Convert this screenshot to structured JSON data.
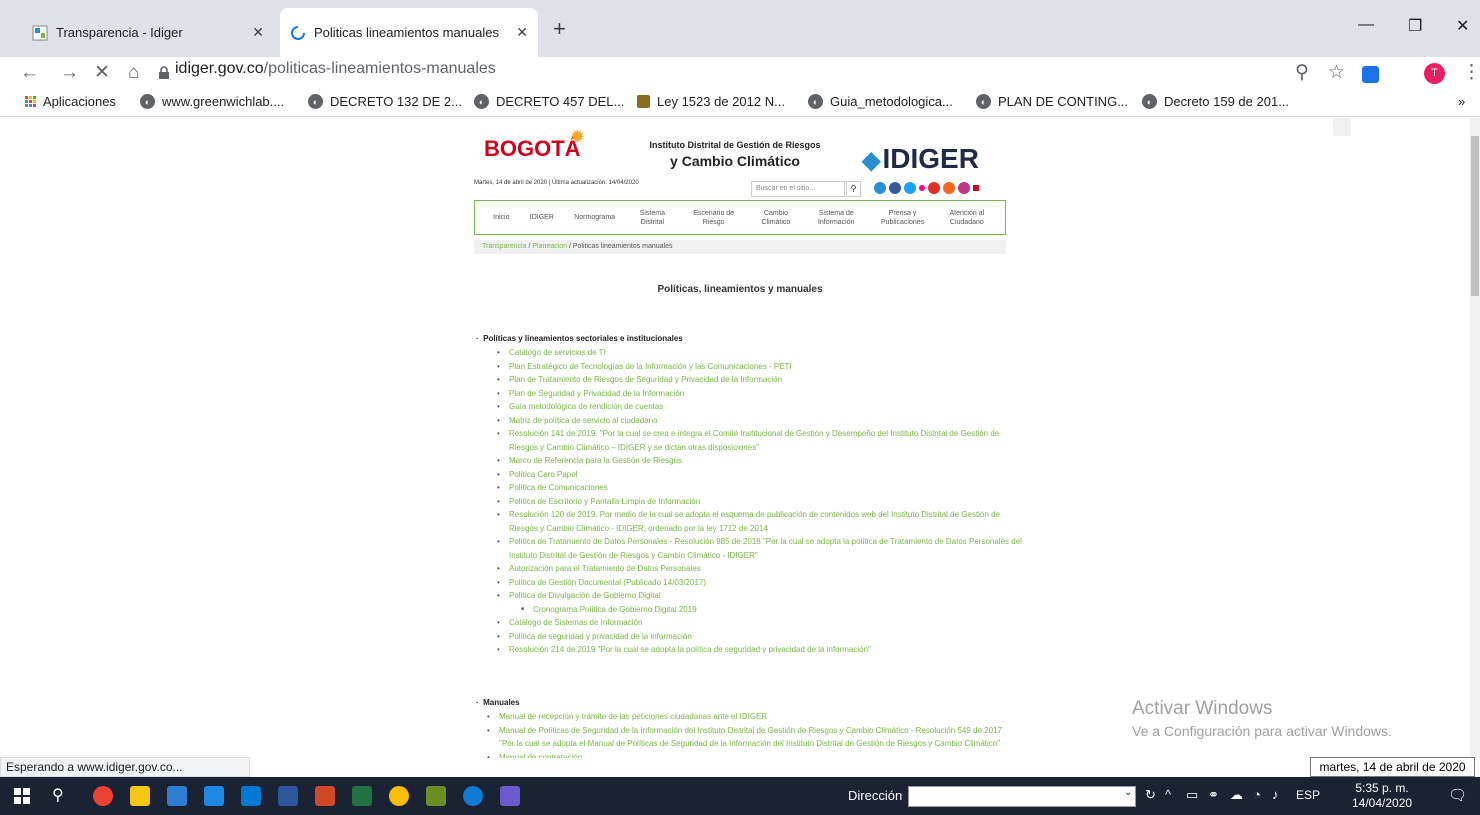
{
  "browser": {
    "tabs": [
      {
        "title": "Transparencia - Idiger",
        "active": false
      },
      {
        "title": "Politicas lineamientos manuales",
        "active": true
      }
    ],
    "new_tab_icon": "plus-icon",
    "url_domain": "idiger.gov.co",
    "url_path": "/politicas-lineamientos-manuales",
    "profile_initial": "T",
    "bookmarks": [
      "Aplicaciones",
      "www.greenwichlab....",
      "DECRETO 132 DE 2...",
      "DECRETO 457 DEL...",
      "Ley 1523 de 2012 N...",
      "Guia_metodologica...",
      "PLAN DE CONTING...",
      "Decreto 159 de 201..."
    ],
    "bookmarks_more": "»",
    "status_text": "Esperando a www.idiger.gov.co...",
    "tooltip_text": "martes, 14 de abril de 2020"
  },
  "site": {
    "logo_left": "BOGOTÁ",
    "institute_line1": "Instituto Distrital de Gestión de Riesgos",
    "institute_line2": "y Cambio Climático",
    "logo_right": "IDIGER",
    "dateline": "Martes, 14 de abril de 2020 | Última actualización: 14/04/2020",
    "search_placeholder": "Buscar en el sitio...",
    "nav": [
      "Inicio",
      "IDIGER",
      "Normograma",
      "Sistema Distrital",
      "Escenario de Riesgo",
      "Cambio Climático",
      "Sistema de Información",
      "Prensa y Publicaciones",
      "Atención al Ciudadano"
    ],
    "breadcrumb": {
      "link1": "Transparencia",
      "link2": "Planeacion",
      "current": "Politicas lineamientos manuales",
      "sep": "/"
    },
    "heading": "Políticas, lineamientos y manuales",
    "section1_title": "Políticas y lineamientos sectoriales e institucionales",
    "section1_items": [
      "Catálogo de servicios de TI",
      "Plan Estratégico de Tecnologías de la Información y las Comunicaciones - PETI",
      "Plan de Tratamiento de Riesgos de Seguridad y Privacidad de la Información",
      "Plan de Seguridad y Privacidad de la Información",
      "Guía metodológica de rendición de cuentas",
      "Matriz de política de servicio al ciudadano",
      "Resolución 141 de 2019. \"Por la cual se crea e integra el Comité Institucional de Gestión y Desempeño del Instituto Distrital de Gestión de Riesgos y Cambio Climático – IDIGER y se dictan otras disposiciones\"",
      "Marco de Referencia para la Gestión de Riesgos",
      "Política Cero Papel",
      "Política de Comunicaciones",
      "Política de Escritorio y Pantalla Limpia de Información",
      "Resolución 120 de 2019. Por medio de la cual se adopta el esquema de publicación de contenidos web del Instituto Distrital de Gestión de Riesgos y Cambio Climático - IDIGER, ordenado por la ley 1712 de 2014",
      "Política de Tratamiento de Datos Personales - Resolución 985 de 2018 \"Por la cual se adopta la política de Tratamiento de Datos Personales del Instituto Distrital de Gestión de Riesgos y Cambio Climático - IDIGER\"",
      "Autorización para el Tratamiento de Datos Personales",
      "Política de Gestión Documental (Publicado 14/03/2017)",
      "Política de Divulgación de Gobierno Digital"
    ],
    "section1_subitem": "Cronograma Política de Gobierno Digital 2019",
    "section1_items_after": [
      "Catálogo de Sistemas de Información",
      "Política de seguridad y privacidad de la información",
      "Resolución 214 de 2019 \"Por la cual se adopta la política de seguridad y privacidad de la información\""
    ],
    "section2_title": "Manuales",
    "section2_items": [
      "Manual de recepción y trámite de las peticiones ciudadanas ante el IDIGER",
      "Manual de Políticas de Seguridad de la Información del Instituto Distrital de Gestión de Riesgos y Cambio Climático - Resolución 549 de 2017 \"Por la cual se adopta el Manual de Políticas de Seguridad de la Información del Instituto Distrital de Gestión de Riesgos y Cambio Climático\"",
      "Manual de contratación"
    ]
  },
  "watermark": {
    "line1": "Activar Windows",
    "line2": "Ve a Configuración para activar Windows."
  },
  "taskbar": {
    "address_label": "Dirección",
    "lang": "ESP",
    "time": "5:35 p. m.",
    "date": "14/04/2020"
  },
  "colors": {
    "link_green": "#7ab648",
    "taskbar": "#1a2234",
    "tabstrip": "#dee1e6"
  }
}
